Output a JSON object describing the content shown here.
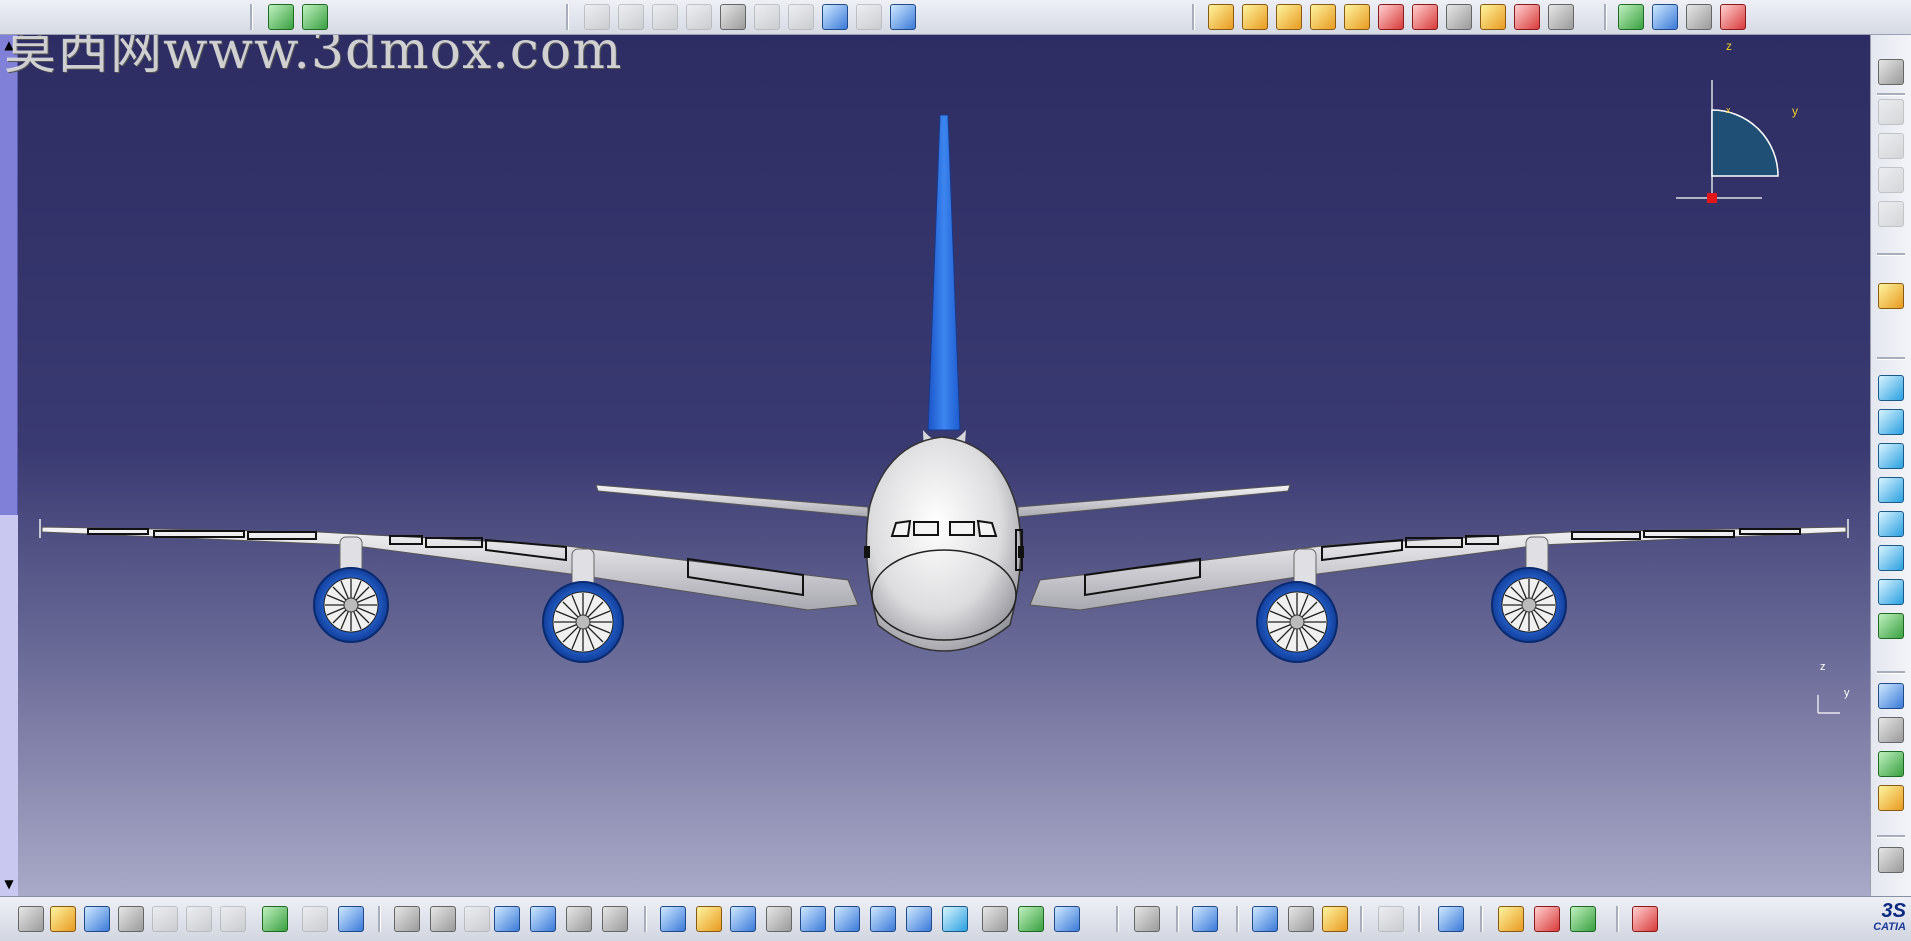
{
  "watermark": "莫西网www.3dmox.com",
  "compass": {
    "z": "z",
    "y": "y",
    "x": "x"
  },
  "mini_axis": {
    "z": "z",
    "y": "y"
  },
  "brand": {
    "logo_top": "3S",
    "logo_name": "CATIA"
  },
  "colors": {
    "background_top": "#2d2d63",
    "background_bottom": "#a9a9c8",
    "fuselage": "#e8e8ea",
    "tail": "#2f6fe0",
    "engine": "#1e6ad8"
  },
  "icons": {
    "top": [
      "sketch-icon",
      "plane-icon",
      "constraint-icon",
      "part-icon",
      "body-icon",
      "shaft-icon",
      "anchor-icon",
      "pencil-icon",
      "clipboard-icon",
      "link-icon",
      "update-icon",
      "graph-icon",
      "multi-icon",
      "gear-icon",
      "gear-icon",
      "arrow-icon",
      "arrow-icon",
      "flag-icon",
      "text-icon",
      "table-icon",
      "chart-icon",
      "wrench-icon",
      "layer-icon",
      "cube-icon",
      "spreadsheet-icon"
    ],
    "bottom": [
      "new-icon",
      "open-icon",
      "save-icon",
      "print-icon",
      "cut-icon",
      "copy-icon",
      "paste-icon",
      "undo-icon",
      "redo-icon",
      "whats-this-icon",
      "formula-icon",
      "comment-icon",
      "knowledge-icon",
      "table-icon",
      "tree-icon",
      "lock-icon",
      "rule-icon",
      "fly-icon",
      "fit-all-icon",
      "pan-icon",
      "rotate-icon",
      "zoom-in-icon",
      "zoom-out-icon",
      "normal-view-icon",
      "multi-view-icon",
      "iso-view-icon",
      "hide-icon",
      "swap-icon",
      "shading-icon",
      "camera-icon",
      "measure-icon",
      "measure-between-icon",
      "material-icon",
      "ruler-icon",
      "apply-material-icon",
      "render-icon",
      "photo-icon",
      "grid-icon",
      "catalog-icon"
    ],
    "right": [
      "settings-icon",
      "doc-icon",
      "doc-icon",
      "doc-icon",
      "doc-icon",
      "select-icon",
      "iso-view-icon",
      "front-view-icon",
      "back-view-icon",
      "left-view-icon",
      "right-view-icon",
      "top-view-icon",
      "bottom-view-icon",
      "named-view-icon",
      "render-style-icon",
      "render-style-icon",
      "sample-icon",
      "light-icon",
      "compass-icon"
    ]
  }
}
